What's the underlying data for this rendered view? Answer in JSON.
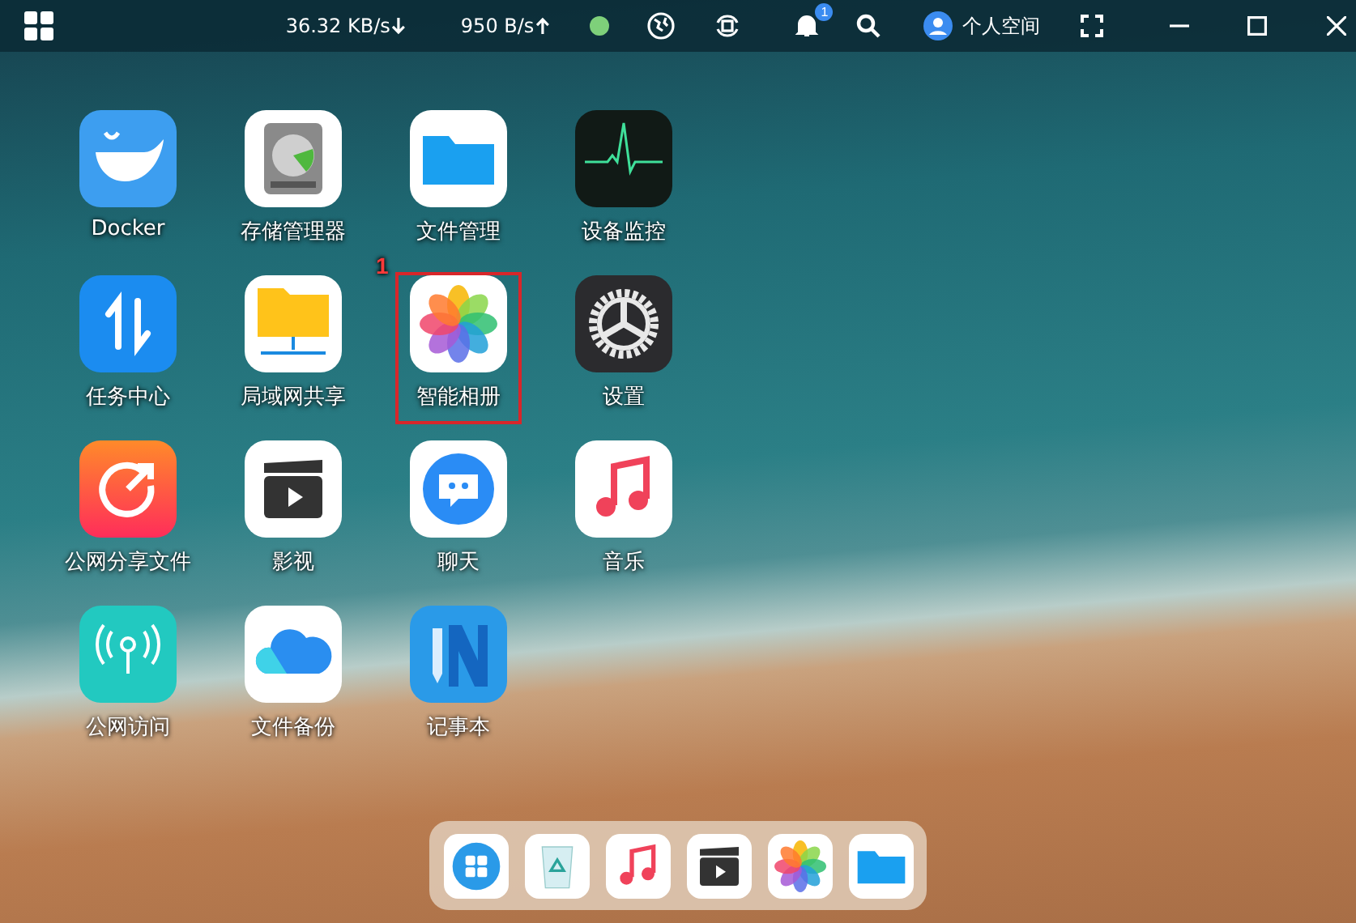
{
  "top_bar": {
    "download_speed": "36.32 KB/s",
    "upload_speed": "950 B/s",
    "status_dot": {
      "color": "#7ed07a"
    },
    "notification_count": "1",
    "user_label": "个人空间"
  },
  "apps": [
    {
      "label": "Docker",
      "kind": "docker",
      "highlighted": false
    },
    {
      "label": "存储管理器",
      "kind": "storage",
      "highlighted": false
    },
    {
      "label": "文件管理",
      "kind": "files",
      "highlighted": false
    },
    {
      "label": "设备监控",
      "kind": "monitor",
      "highlighted": false
    },
    {
      "label": "任务中心",
      "kind": "tasks",
      "highlighted": false
    },
    {
      "label": "局域网共享",
      "kind": "lan-share",
      "highlighted": false
    },
    {
      "label": "智能相册",
      "kind": "photos",
      "highlighted": true,
      "annotation": "1"
    },
    {
      "label": "设置",
      "kind": "settings",
      "highlighted": false
    },
    {
      "label": "公网分享文件",
      "kind": "share",
      "highlighted": false
    },
    {
      "label": "影视",
      "kind": "video",
      "highlighted": false
    },
    {
      "label": "聊天",
      "kind": "chat",
      "highlighted": false
    },
    {
      "label": "音乐",
      "kind": "music",
      "highlighted": false
    },
    {
      "label": "公网访问",
      "kind": "remote",
      "highlighted": false
    },
    {
      "label": "文件备份",
      "kind": "backup",
      "highlighted": false
    },
    {
      "label": "记事本",
      "kind": "notes",
      "highlighted": false
    }
  ],
  "dock": [
    {
      "kind": "launcher"
    },
    {
      "kind": "trash"
    },
    {
      "kind": "music"
    },
    {
      "kind": "video"
    },
    {
      "kind": "photos"
    },
    {
      "kind": "files"
    }
  ]
}
